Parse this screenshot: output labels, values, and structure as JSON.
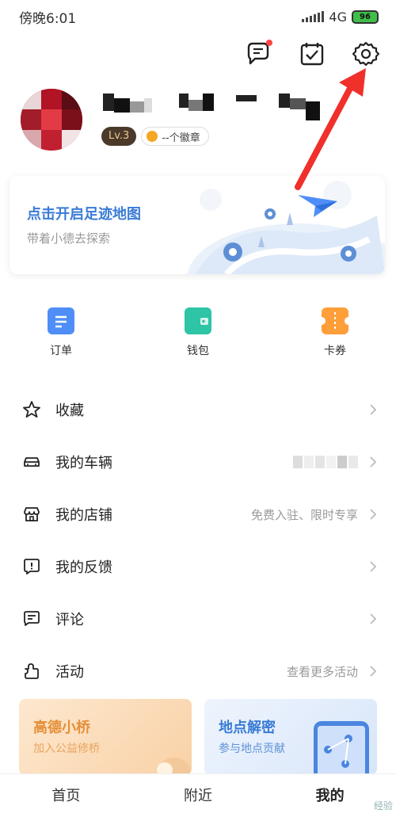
{
  "status_bar": {
    "time": "傍晚6:01",
    "network": "4G",
    "battery": "96"
  },
  "top_icons": [
    "message-icon",
    "checkin-calendar-icon",
    "settings-gear-icon"
  ],
  "profile": {
    "level": "Lv.3",
    "medal": "--个徽章"
  },
  "footprint": {
    "title": "点击开启足迹地图",
    "subtitle": "带着小德去探索"
  },
  "quick_actions": [
    {
      "label": "订单",
      "icon": "order-icon",
      "color": "#4f8ef7"
    },
    {
      "label": "钱包",
      "icon": "wallet-icon",
      "color": "#2ec4a6"
    },
    {
      "label": "卡券",
      "icon": "coupon-icon",
      "color": "#ff9f3a"
    }
  ],
  "menu": [
    {
      "label": "收藏",
      "value": "",
      "icon": "star-icon"
    },
    {
      "label": "我的车辆",
      "value": "",
      "icon": "car-icon"
    },
    {
      "label": "我的店铺",
      "value": "免费入驻、限时专享",
      "icon": "store-icon"
    },
    {
      "label": "我的反馈",
      "value": "",
      "icon": "feedback-icon"
    },
    {
      "label": "评论",
      "value": "",
      "icon": "comment-icon"
    },
    {
      "label": "活动",
      "value": "查看更多活动",
      "icon": "activity-icon"
    }
  ],
  "cards": [
    {
      "title": "高德小桥",
      "subtitle": "加入公益修桥",
      "color": "#e5903a"
    },
    {
      "title": "地点解密",
      "subtitle": "参与地点贡献",
      "color": "#3a7bd5"
    }
  ],
  "tabs": [
    "首页",
    "附近",
    "我的"
  ],
  "watermark": "经验"
}
